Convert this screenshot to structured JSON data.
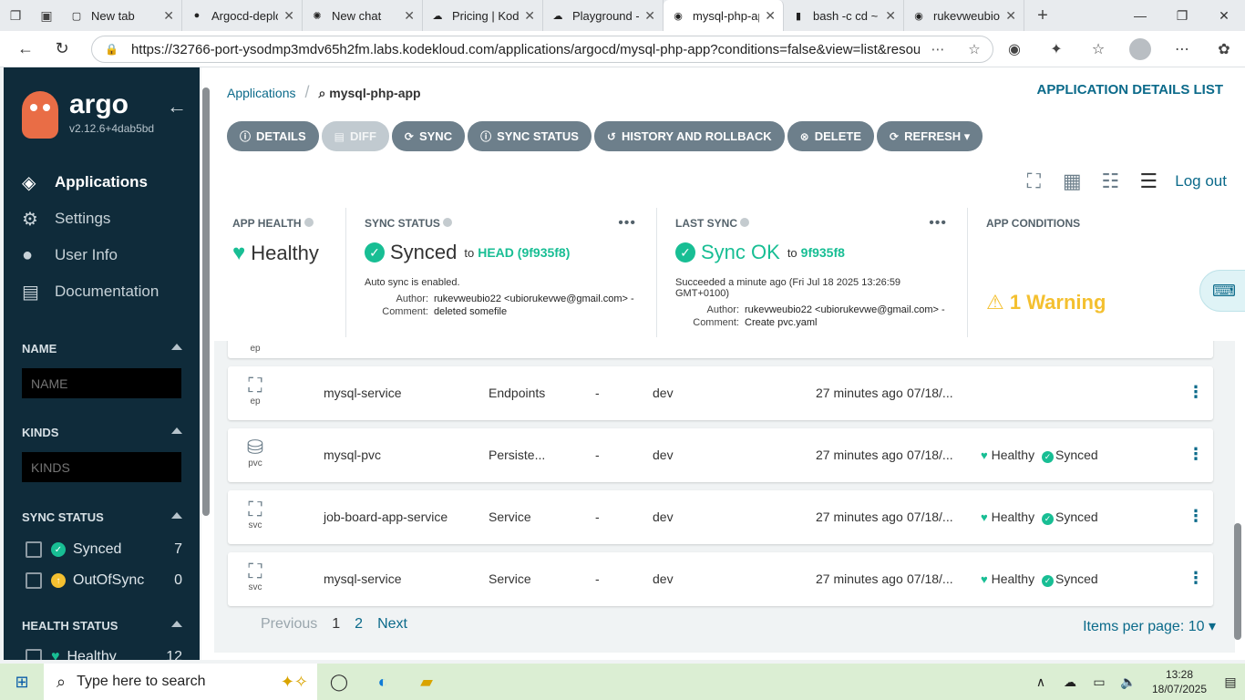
{
  "browser": {
    "tabs": [
      {
        "title": "New tab",
        "icon": "newtab-icon",
        "active": false
      },
      {
        "title": "Argocd-deplo",
        "icon": "github-icon",
        "active": false
      },
      {
        "title": "New chat",
        "icon": "chatgpt-icon",
        "active": false
      },
      {
        "title": "Pricing | Kode",
        "icon": "cloud-icon",
        "active": false
      },
      {
        "title": "Playground -",
        "icon": "cloud-icon",
        "active": false
      },
      {
        "title": "mysql-php-ap",
        "icon": "argo-icon",
        "active": true
      },
      {
        "title": "bash -c cd ~",
        "icon": "terminal-icon",
        "active": false
      },
      {
        "title": "rukevweubio",
        "icon": "argo-icon",
        "active": false
      }
    ],
    "url": "https://32766-port-ysodmp3mdv65h2fm.labs.kodekloud.com/applications/argocd/mysql-php-app?conditions=false&view=list&resourc..."
  },
  "sidebar": {
    "brand": "argo",
    "version": "v2.12.6+4dab5bd",
    "nav": [
      {
        "label": "Applications",
        "icon": "layers-icon",
        "active": true
      },
      {
        "label": "Settings",
        "icon": "gear-icon",
        "active": false
      },
      {
        "label": "User Info",
        "icon": "user-icon",
        "active": false
      },
      {
        "label": "Documentation",
        "icon": "book-icon",
        "active": false
      }
    ],
    "name_header": "NAME",
    "name_placeholder": "NAME",
    "kinds_header": "KINDS",
    "kinds_placeholder": "KINDS",
    "sync_header": "SYNC STATUS",
    "sync_items": [
      {
        "label": "Synced",
        "count": "7",
        "color": "#18be94"
      },
      {
        "label": "OutOfSync",
        "count": "0",
        "color": "#f4c030"
      }
    ],
    "health_header": "HEALTH STATUS",
    "health_items": [
      {
        "label": "Healthy",
        "count": "12"
      }
    ]
  },
  "header": {
    "breadcrumb_root": "Applications",
    "breadcrumb_current": "mysql-php-app",
    "title": "APPLICATION DETAILS LIST"
  },
  "actions": [
    {
      "label": "DETAILS",
      "icon": "info-icon",
      "disabled": false
    },
    {
      "label": "DIFF",
      "icon": "file-icon",
      "disabled": true
    },
    {
      "label": "SYNC",
      "icon": "sync-icon",
      "disabled": false
    },
    {
      "label": "SYNC STATUS",
      "icon": "info-icon",
      "disabled": false
    },
    {
      "label": "HISTORY AND ROLLBACK",
      "icon": "history-icon",
      "disabled": false
    },
    {
      "label": "DELETE",
      "icon": "delete-icon",
      "disabled": false
    },
    {
      "label": "REFRESH ▾",
      "icon": "refresh-icon",
      "disabled": false
    }
  ],
  "logout": "Log out",
  "status": {
    "app_health_label": "APP HEALTH",
    "app_health_value": "Healthy",
    "sync_status_label": "SYNC STATUS",
    "sync_status_value": "Synced",
    "sync_to": "to",
    "sync_rev": "HEAD (9f935f8)",
    "auto_sync": "Auto sync is enabled.",
    "sync_author_label": "Author:",
    "sync_author": "rukevweubio22 <ubiorukevwe@gmail.com> -",
    "sync_comment_label": "Comment:",
    "sync_comment": "deleted somefile",
    "last_sync_label": "LAST SYNC",
    "last_sync_value": "Sync OK",
    "last_sync_to": "to",
    "last_sync_rev": "9f935f8",
    "last_sync_time": "Succeeded a minute ago (Fri Jul 18 2025 13:26:59 GMT+0100)",
    "last_author_label": "Author:",
    "last_author": "rukevweubio22 <ubiorukevwe@gmail.com> -",
    "last_comment_label": "Comment:",
    "last_comment": "Create pvc.yaml",
    "conditions_label": "APP CONDITIONS",
    "conditions_value": "1 Warning"
  },
  "resources": {
    "partial_kind": "ep",
    "rows": [
      {
        "kind_short": "ep",
        "name": "mysql-service",
        "kind": "Endpoints",
        "group": "-",
        "namespace": "dev",
        "age": "27 minutes ago",
        "date": "07/18/...",
        "health": "",
        "sync": ""
      },
      {
        "kind_short": "pvc",
        "name": "mysql-pvc",
        "kind": "Persiste...",
        "group": "-",
        "namespace": "dev",
        "age": "27 minutes ago",
        "date": "07/18/...",
        "health": "Healthy",
        "sync": "Synced"
      },
      {
        "kind_short": "svc",
        "name": "job-board-app-service",
        "kind": "Service",
        "group": "-",
        "namespace": "dev",
        "age": "27 minutes ago",
        "date": "07/18/...",
        "health": "Healthy",
        "sync": "Synced"
      },
      {
        "kind_short": "svc",
        "name": "mysql-service",
        "kind": "Service",
        "group": "-",
        "namespace": "dev",
        "age": "27 minutes ago",
        "date": "07/18/...",
        "health": "Healthy",
        "sync": "Synced"
      }
    ]
  },
  "pagination": {
    "previous": "Previous",
    "pages": [
      "1",
      "2"
    ],
    "next": "Next",
    "per_page": "Items per page: 10"
  },
  "taskbar": {
    "search_placeholder": "Type here to search",
    "time": "13:28",
    "date": "18/07/2025"
  }
}
